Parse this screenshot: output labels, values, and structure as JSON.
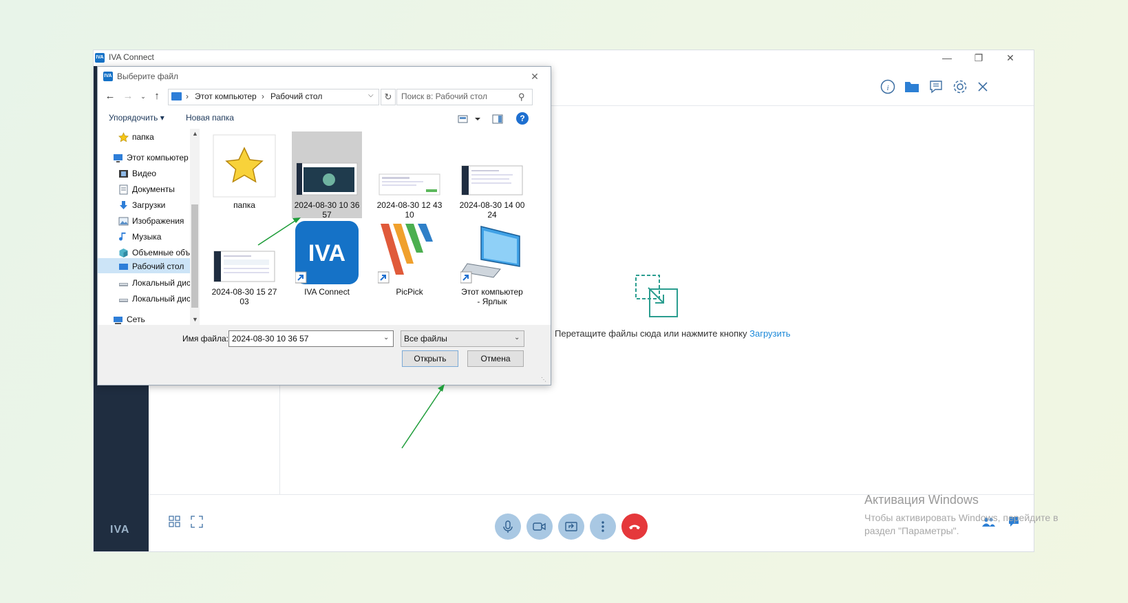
{
  "app": {
    "window_title": "IVA Connect",
    "logo_text": "IVA",
    "drop_text": "Перетащите файлы сюда или нажмите кнопку",
    "drop_link": "Загрузить",
    "activation_title": "Активация Windows",
    "activation_sub": "Чтобы активировать Windows, перейдите в раздел \"Параметры\".",
    "accent_color": "#1a88d8",
    "hangup_color": "#e5383b"
  },
  "dialog": {
    "title": "Выберите файл",
    "address": [
      "Этот компьютер",
      "Рабочий стол"
    ],
    "search_placeholder": "Поиск в: Рабочий стол",
    "toolbar": {
      "organize": "Упорядочить ▾",
      "new_folder": "Новая папка"
    },
    "nav_items": [
      {
        "label": "папка",
        "icon": "star-icon"
      },
      {
        "label": "Этот компьютер",
        "icon": "computer-icon"
      },
      {
        "label": "Видео",
        "icon": "video-icon"
      },
      {
        "label": "Документы",
        "icon": "document-icon"
      },
      {
        "label": "Загрузки",
        "icon": "download-icon"
      },
      {
        "label": "Изображения",
        "icon": "image-icon"
      },
      {
        "label": "Музыка",
        "icon": "music-icon"
      },
      {
        "label": "Объемные объ",
        "icon": "cube-icon"
      },
      {
        "label": "Рабочий стол",
        "icon": "desktop-icon",
        "selected": true
      },
      {
        "label": "Локальный дис",
        "icon": "drive-icon"
      },
      {
        "label": "Локальный дис",
        "icon": "drive-icon"
      },
      {
        "label": "Сеть",
        "icon": "network-icon"
      }
    ],
    "files": [
      {
        "line1": "папка",
        "line2": ""
      },
      {
        "line1": "2024-08-30 10 36",
        "line2": "57",
        "selected": true
      },
      {
        "line1": "2024-08-30 12 43",
        "line2": "10"
      },
      {
        "line1": "2024-08-30 14 00",
        "line2": "24"
      },
      {
        "line1": "2024-08-30 15 27",
        "line2": "03"
      },
      {
        "line1": "IVA Connect",
        "line2": ""
      },
      {
        "line1": "PicPick",
        "line2": ""
      },
      {
        "line1": "Этот компьютер",
        "line2": "- Ярлык"
      }
    ],
    "filename_label": "Имя файла:",
    "filename_value": "2024-08-30 10 36 57",
    "filetype_value": "Все файлы",
    "open_button": "Открыть",
    "cancel_button": "Отмена"
  }
}
